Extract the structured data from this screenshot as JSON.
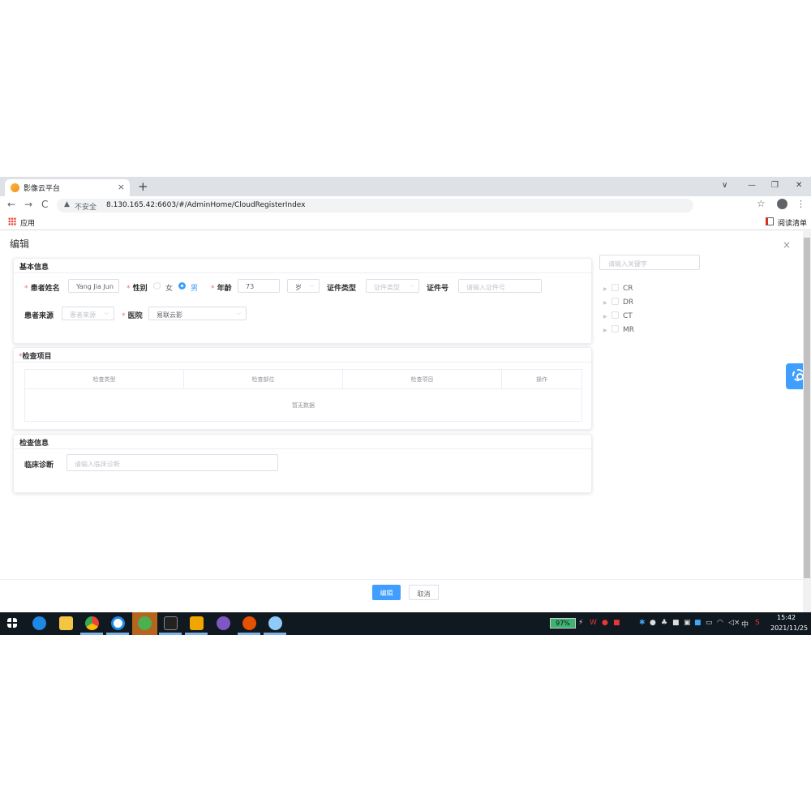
{
  "browser": {
    "tab_title": "影像云平台",
    "tab_close": "×",
    "new_tab": "+",
    "min": "∨",
    "minimize": "—",
    "restore": "❐",
    "close": "✕",
    "back": "←",
    "forward": "→",
    "reload": "C",
    "warning_icon": "▲",
    "insecure_label": "不安全",
    "url": "8.130.165.42:6603/#/AdminHome/CloudRegisterIndex",
    "star": "☆",
    "menu": "⋮",
    "bookmark_apps": "应用",
    "reading_list": "阅读清单"
  },
  "dialog": {
    "title": "编辑",
    "close": "×"
  },
  "basic": {
    "section_title": "基本信息",
    "required_mark": "*",
    "patient_name_label": "患者姓名",
    "patient_name_value": "Yang Jia Jun",
    "gender_label": "性别",
    "gender_female": "女",
    "gender_male": "男",
    "gender_selected": "男",
    "age_label": "年龄",
    "age_value": "73",
    "age_unit": "岁",
    "id_type_label": "证件类型",
    "id_type_placeholder": "证件类型",
    "id_no_label": "证件号",
    "id_no_placeholder": "请输入证件号",
    "source_label": "患者来源",
    "source_placeholder": "患者来源",
    "hospital_label": "医院",
    "hospital_value": "易联云影"
  },
  "exam": {
    "section_title": "检查项目",
    "required_mark": "*",
    "columns": [
      "检查类型",
      "检查部位",
      "检查项目",
      "操作"
    ],
    "empty_text": "暂无数据"
  },
  "exam_info": {
    "section_title": "检查信息",
    "diagnosis_label": "临床诊断",
    "diagnosis_placeholder": "请输入临床诊断"
  },
  "right_panel": {
    "search_placeholder": "请输入关键字",
    "tree": [
      "CR",
      "DR",
      "CT",
      "MR"
    ]
  },
  "footer": {
    "primary_label": "编辑",
    "cancel_label": "取消"
  },
  "taskbar": {
    "battery": "97%",
    "ime": "中",
    "time": "15:42",
    "date": "2021/11/25"
  },
  "colors": {
    "primary": "#409eff",
    "required": "#f56c6c",
    "taskbar": "#101820"
  }
}
